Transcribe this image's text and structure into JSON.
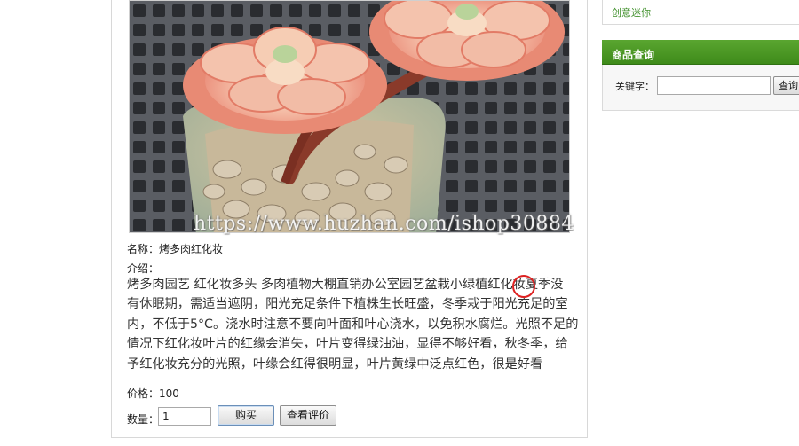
{
  "product": {
    "name_label": "名称：烤多肉红化妆",
    "intro_label": "介绍：",
    "description_lines": [
      "烤多肉园艺 红化妆多头 多肉植物大棚直销办公室园艺盆栽小绿植红化妆夏季没",
      "有休眠期，需适当遮阴，阳光充足条件下植株生长旺盛，冬季栽于阳光充足的室",
      "内，不低于5°C。浇水时注意不要向叶面和叶心浇水，以免积水腐烂。光照不足的",
      "情况下红化妆叶片的红缘会消失，叶片变得绿油油，显得不够好看，秋冬季，给",
      "予红化妆充分的光照，叶缘会红得很明显，叶片黄绿中泛点红色，很是好看"
    ],
    "price_label": "价格：100",
    "quantity_label": "数量：",
    "quantity_value": "1",
    "buy_button": "购买",
    "review_button": "查看评价",
    "watermark": "https://www.huzhan.com/ishop30884"
  },
  "sidebar": {
    "top_link": "创意迷你",
    "search_title": "商品查询",
    "keyword_label": "关键字：",
    "keyword_value": "",
    "search_button": "查询"
  },
  "colors": {
    "sidebar_header": "#4a9a24",
    "link_green": "#3f8f2a",
    "annotation_circle": "#dd2222"
  }
}
